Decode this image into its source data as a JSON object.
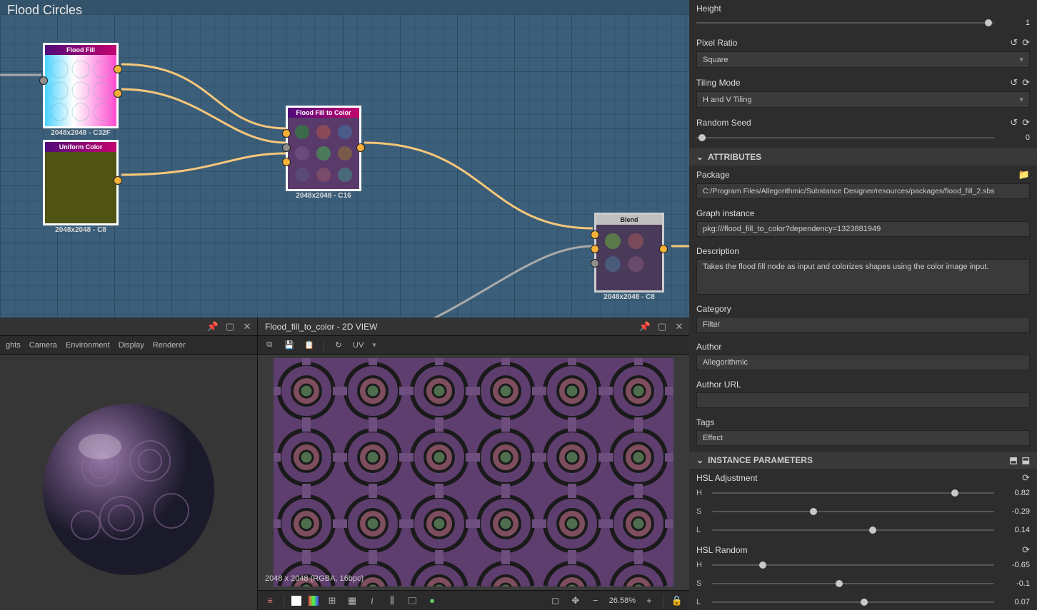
{
  "graph": {
    "title": "Flood Circles",
    "nodes": {
      "flood_fill": {
        "label": "Flood Fill",
        "caption": "2048x2048 - C32F"
      },
      "uniform_color": {
        "label": "Uniform Color",
        "caption": "2048x2048 - C8"
      },
      "flood_fill_to_color": {
        "label": "Flood Fill to Color",
        "caption": "2048x2048 - C16"
      },
      "blend": {
        "label": "Blend",
        "caption": "2048x2048 - C8"
      }
    }
  },
  "view3d": {
    "menu": [
      "ghts",
      "Camera",
      "Environment",
      "Display",
      "Renderer"
    ]
  },
  "view2d": {
    "title": "Flood_fill_to_color - 2D VIEW",
    "menu_uv": "UV",
    "status": "2048 x 2048 (RGBA, 16bpc)",
    "zoom": "26.58%"
  },
  "props": {
    "height": {
      "label": "Height",
      "value": "1"
    },
    "pixel_ratio": {
      "label": "Pixel Ratio",
      "value": "Square"
    },
    "tiling_mode": {
      "label": "Tiling Mode",
      "value": "H and V Tiling"
    },
    "random_seed": {
      "label": "Random Seed",
      "value": "0"
    }
  },
  "attributes": {
    "section": "ATTRIBUTES",
    "package": {
      "label": "Package",
      "value": "C:/Program Files/Allegorithmic/Substance Designer/resources/packages/flood_fill_2.sbs"
    },
    "graph_instance": {
      "label": "Graph instance",
      "value": "pkg:///flood_fill_to_color?dependency=1323881949"
    },
    "description": {
      "label": "Description",
      "value": "Takes the flood fill node as input and colorizes shapes using the color image input."
    },
    "category": {
      "label": "Category",
      "value": "Filter"
    },
    "author": {
      "label": "Author",
      "value": "Allegorithmic"
    },
    "author_url": {
      "label": "Author URL",
      "value": ""
    },
    "tags": {
      "label": "Tags",
      "value": "Effect"
    }
  },
  "instance": {
    "section": "INSTANCE PARAMETERS",
    "hsl_adj": {
      "label": "HSL Adjustment",
      "h": "0.82",
      "s": "-0.29",
      "l": "0.14"
    },
    "hsl_rand": {
      "label": "HSL Random",
      "h": "-0.65",
      "s": "-0.1",
      "l": "0.07"
    }
  }
}
